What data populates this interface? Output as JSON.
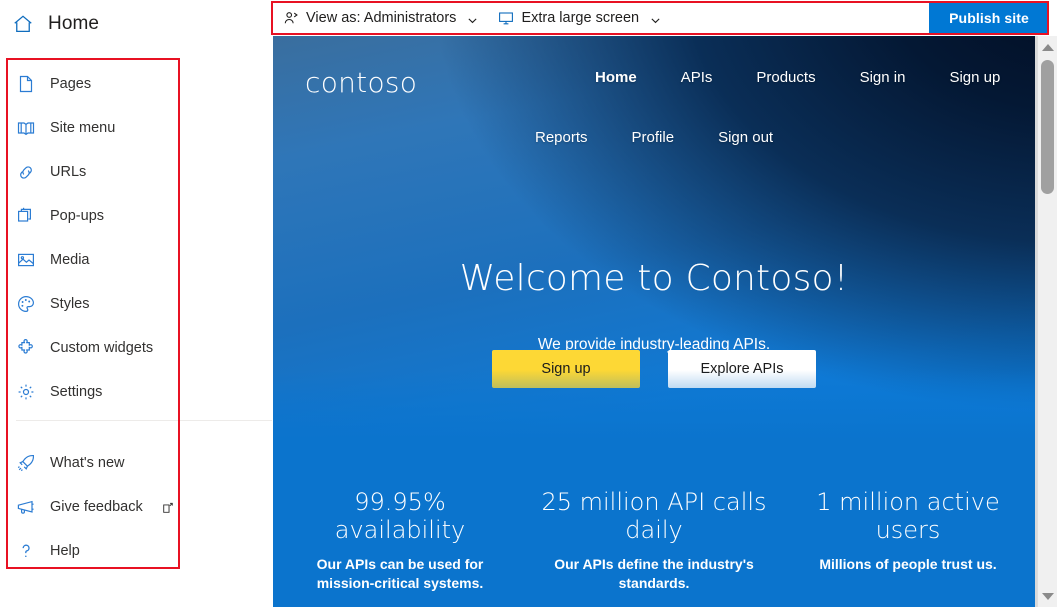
{
  "header": {
    "title": "Home",
    "icon": "home-icon"
  },
  "sidebar": {
    "primary_items": [
      {
        "label": "Pages",
        "icon": "page-icon"
      },
      {
        "label": "Site menu",
        "icon": "book-icon"
      },
      {
        "label": "URLs",
        "icon": "link-icon"
      },
      {
        "label": "Pop-ups",
        "icon": "popup-icon"
      },
      {
        "label": "Media",
        "icon": "image-icon"
      },
      {
        "label": "Styles",
        "icon": "palette-icon"
      },
      {
        "label": "Custom widgets",
        "icon": "puzzle-icon"
      },
      {
        "label": "Settings",
        "icon": "gear-icon"
      }
    ],
    "secondary_items": [
      {
        "label": "What's new",
        "icon": "rocket-icon",
        "external": false
      },
      {
        "label": "Give feedback",
        "icon": "megaphone-icon",
        "external": true
      },
      {
        "label": "Help",
        "icon": "question-icon",
        "external": false
      }
    ]
  },
  "toolbar": {
    "view_as": {
      "icon": "person-icon",
      "label": "View as: Administrators",
      "chevron": "chevron-down-icon"
    },
    "screen_size": {
      "icon": "monitor-icon",
      "label": "Extra large screen",
      "chevron": "chevron-down-icon"
    },
    "publish_label": "Publish site"
  },
  "preview": {
    "logo": "contoso",
    "nav_row1": [
      {
        "label": "Home",
        "active": true
      },
      {
        "label": "APIs",
        "active": false
      },
      {
        "label": "Products",
        "active": false
      },
      {
        "label": "Sign in",
        "active": false
      },
      {
        "label": "Sign up",
        "active": false
      }
    ],
    "nav_row2": [
      {
        "label": "Reports",
        "active": false
      },
      {
        "label": "Profile",
        "active": false
      },
      {
        "label": "Sign out",
        "active": false
      }
    ],
    "hero": {
      "title": "Welcome to Contoso!",
      "subtitle": "We provide industry-leading APIs.",
      "primary_button": "Sign up",
      "secondary_button": "Explore APIs"
    },
    "stats": [
      {
        "value": "99.95% availability",
        "description": "Our APIs can be used for mission-critical systems."
      },
      {
        "value": "25 million API calls daily",
        "description": "Our APIs define the industry's standards."
      },
      {
        "value": "1 million active users",
        "description": "Millions of people trust us."
      }
    ]
  },
  "scrollbar": {
    "up_icon": "scroll-up-arrow-icon",
    "down_icon": "scroll-down-arrow-icon"
  },
  "colors": {
    "accent": "#0078d4",
    "annotation": "#e81123",
    "hero_blue": "#0b74cd",
    "cta_yellow": "#fdd835"
  }
}
